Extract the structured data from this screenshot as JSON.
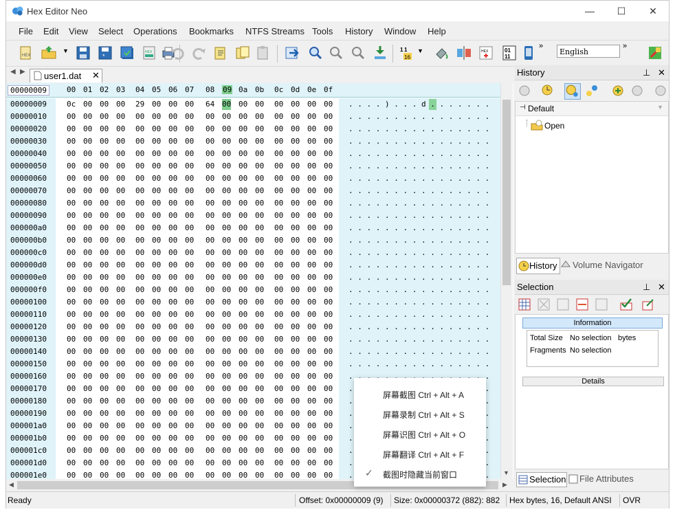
{
  "window": {
    "title": "Hex Editor Neo"
  },
  "menu": [
    "File",
    "Edit",
    "View",
    "Select",
    "Operations",
    "Bookmarks",
    "NTFS Streams",
    "Tools",
    "History",
    "Window",
    "Help"
  ],
  "toolbar": {
    "language": "English",
    "overflow": "»"
  },
  "document": {
    "tab_label": "user1.dat"
  },
  "hex": {
    "header_addr": "00000009",
    "header_cols": [
      "00",
      "01",
      "02",
      "03",
      "04",
      "05",
      "06",
      "07",
      "08",
      "09",
      "0a",
      "0b",
      "0c",
      "0d",
      "0e",
      "0f"
    ],
    "rows": [
      {
        "addr": "00000009",
        "bytes": [
          "0c",
          "00",
          "00",
          "00",
          "29",
          "00",
          "00",
          "00",
          "64",
          "00",
          "00",
          "00",
          "00",
          "00",
          "00",
          "00"
        ],
        "ascii": ". . . . ) . . . d . . . . . . ."
      },
      {
        "addr": "00000010"
      },
      {
        "addr": "00000020"
      },
      {
        "addr": "00000030"
      },
      {
        "addr": "00000040"
      },
      {
        "addr": "00000050"
      },
      {
        "addr": "00000060"
      },
      {
        "addr": "00000070"
      },
      {
        "addr": "00000080"
      },
      {
        "addr": "00000090"
      },
      {
        "addr": "000000a0"
      },
      {
        "addr": "000000b0"
      },
      {
        "addr": "000000c0"
      },
      {
        "addr": "000000d0"
      },
      {
        "addr": "000000e0"
      },
      {
        "addr": "000000f0"
      },
      {
        "addr": "00000100"
      },
      {
        "addr": "00000110"
      },
      {
        "addr": "00000120"
      },
      {
        "addr": "00000130"
      },
      {
        "addr": "00000140"
      },
      {
        "addr": "00000150"
      },
      {
        "addr": "00000160"
      },
      {
        "addr": "00000170"
      },
      {
        "addr": "00000180"
      },
      {
        "addr": "00000190"
      },
      {
        "addr": "000001a0"
      },
      {
        "addr": "000001b0"
      },
      {
        "addr": "000001c0"
      },
      {
        "addr": "000001d0"
      },
      {
        "addr": "000001e0"
      }
    ],
    "zero_byte": "00",
    "zero_ascii": ". . . . . . . . . . . . . . . .",
    "selected_col": 9,
    "highlight_color": "#7fcf8f",
    "panel_color": "#dff3f9"
  },
  "history_panel": {
    "title": "History",
    "tree_root": "Default",
    "tree_item": "Open",
    "tabs": [
      "History",
      "Volume Navigator"
    ]
  },
  "selection_panel": {
    "title": "Selection",
    "info_header": "Information",
    "rows": [
      {
        "label": "Total Size",
        "value": "No selection",
        "unit": "bytes"
      },
      {
        "label": "Fragments",
        "value": "No selection",
        "unit": ""
      }
    ],
    "details_header": "Details",
    "tabs": [
      "Selection",
      "File Attributes"
    ]
  },
  "context_menu": {
    "items": [
      {
        "label": "屏幕截图 Ctrl + Alt + A",
        "checked": false
      },
      {
        "label": "屏幕录制 Ctrl + Alt + S",
        "checked": false
      },
      {
        "label": "屏幕识图 Ctrl + Alt + O",
        "checked": false
      },
      {
        "label": "屏幕翻译 Ctrl + Alt + F",
        "checked": false
      },
      {
        "label": "截图时隐藏当前窗口",
        "checked": true
      }
    ]
  },
  "status": {
    "ready": "Ready",
    "offset": "Offset: 0x00000009 (9)",
    "size": "Size: 0x00000372 (882): 882",
    "mode": "Hex bytes, 16, Default ANSI",
    "ovr": "OVR"
  }
}
